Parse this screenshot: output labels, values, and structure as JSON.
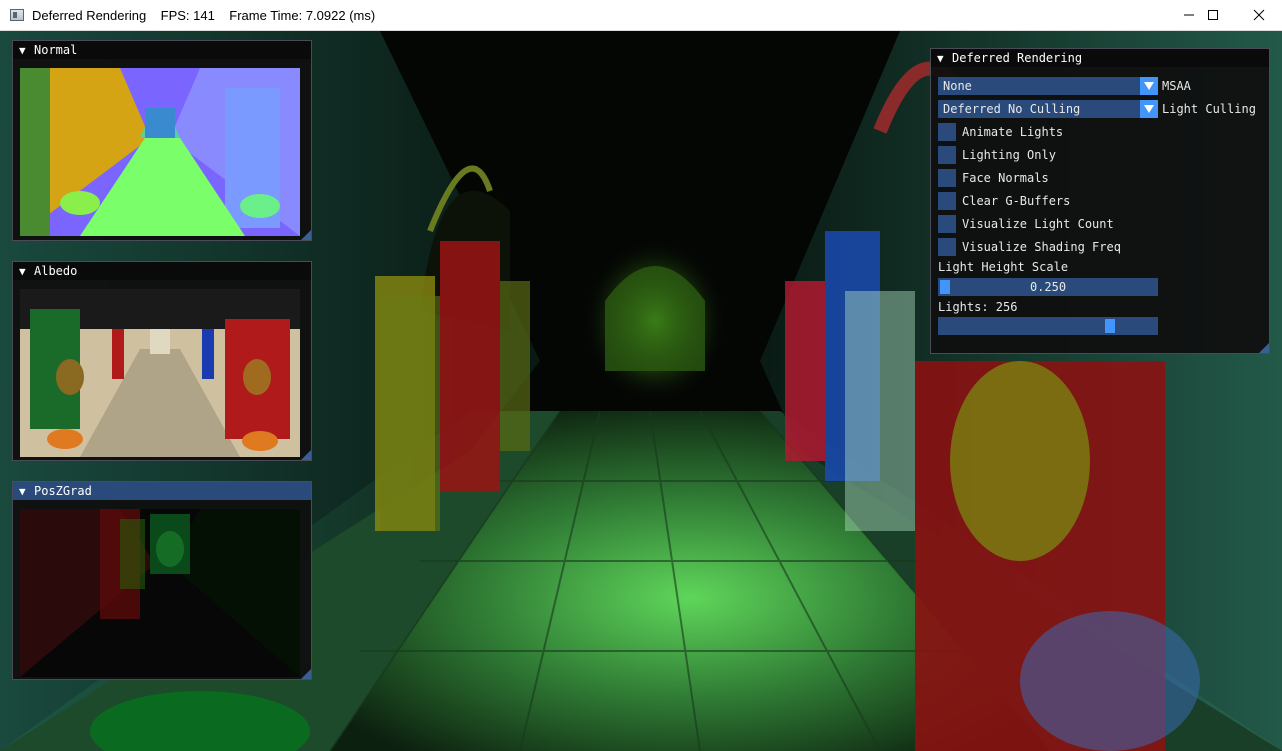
{
  "window": {
    "title": "Deferred Rendering",
    "fps": "FPS: 141",
    "frame_time": "Frame Time: 7.0922 (ms)",
    "title_full": "Deferred Rendering    FPS: 141    Frame Time: 7.0922 (ms)",
    "controls": [
      "minimize-icon",
      "maximize-icon",
      "close-icon"
    ]
  },
  "gbuffer_views": [
    {
      "title": "Normal",
      "active": false
    },
    {
      "title": "Albedo",
      "active": false
    },
    {
      "title": "PosZGrad",
      "active": true
    }
  ],
  "settings": {
    "title": "Deferred Rendering",
    "msaa": {
      "value": "None",
      "label": "MSAA"
    },
    "light_culling": {
      "value": "Deferred No Culling",
      "label": "Light Culling"
    },
    "checkboxes": [
      {
        "label": "Animate Lights",
        "checked": false
      },
      {
        "label": "Lighting Only",
        "checked": false
      },
      {
        "label": "Face Normals",
        "checked": false
      },
      {
        "label": "Clear G-Buffers",
        "checked": false
      },
      {
        "label": "Visualize Light Count",
        "checked": false
      },
      {
        "label": "Visualize Shading Freq",
        "checked": false
      }
    ],
    "light_height_scale": {
      "label": "Light Height Scale",
      "value": "0.250",
      "fraction": 0.0
    },
    "lights": {
      "label": "Lights: 256",
      "fraction": 0.8
    }
  },
  "colors": {
    "accent": "#4296fa",
    "frame_bg": "#294a7a",
    "title_active": "#294a7a",
    "panel_bg": "#0f0f0f"
  }
}
